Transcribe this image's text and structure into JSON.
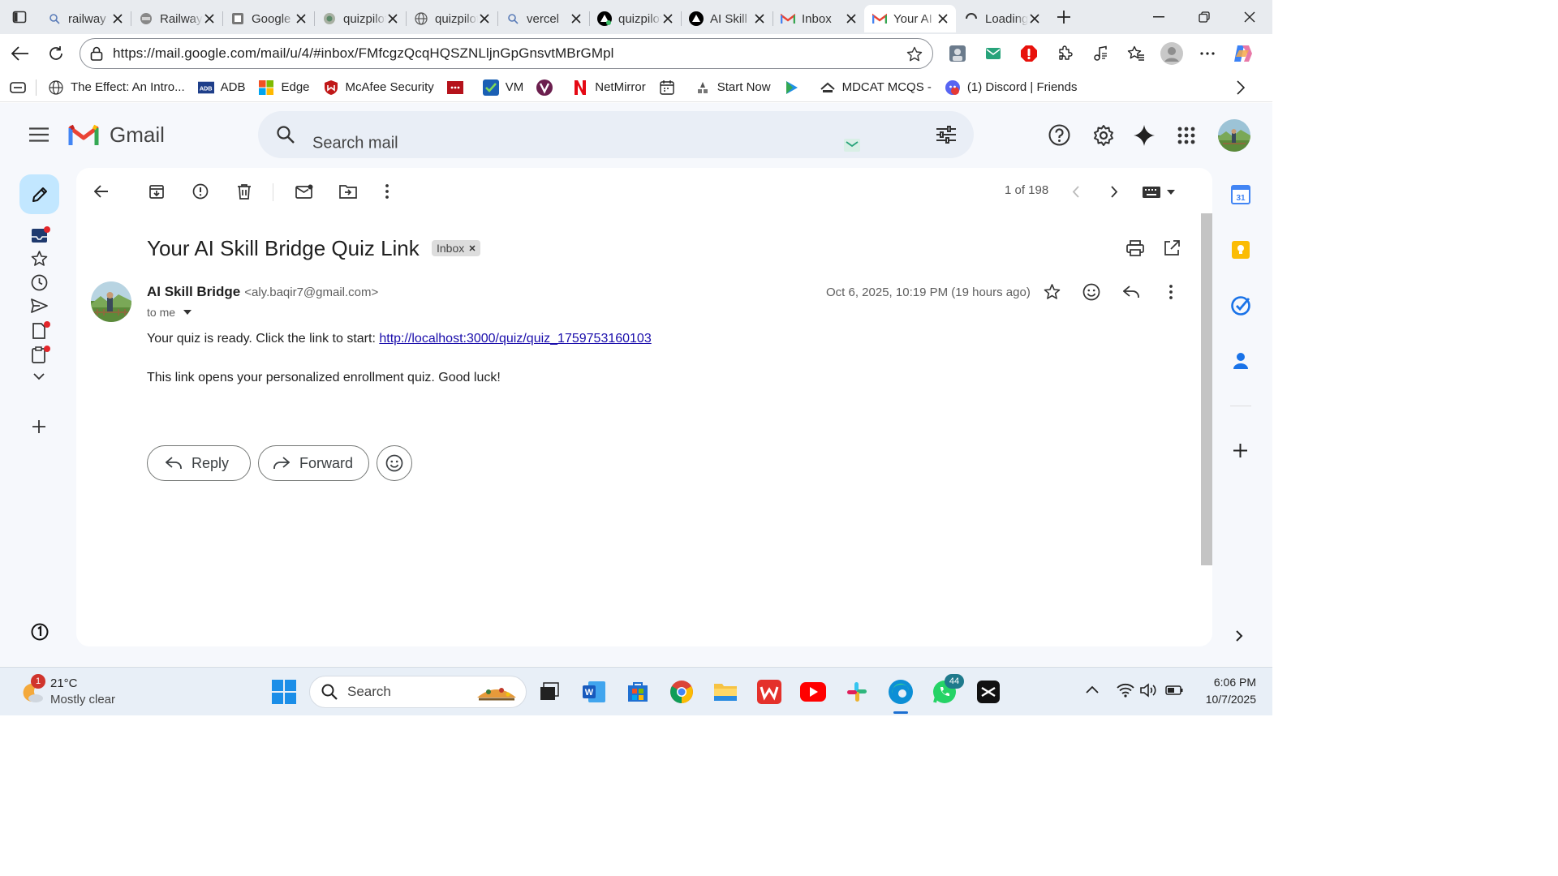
{
  "tabs": [
    {
      "title": "railway",
      "icon": "search-icon"
    },
    {
      "title": "Railway",
      "icon": "railway-icon"
    },
    {
      "title": "Google",
      "icon": "google-icon"
    },
    {
      "title": "quizpilot",
      "icon": "quizpilot-icon"
    },
    {
      "title": "quizpilot",
      "icon": "globe-icon"
    },
    {
      "title": "vercel",
      "icon": "search-icon"
    },
    {
      "title": "quizpilot",
      "icon": "vercel-icon"
    },
    {
      "title": "AI Skill",
      "icon": "vercel-icon"
    },
    {
      "title": "Inbox",
      "icon": "gmail-icon"
    },
    {
      "title": "Your AI",
      "icon": "gmail-icon",
      "active": true
    },
    {
      "title": "Loading",
      "icon": "loading-icon"
    }
  ],
  "address": {
    "url": "https://mail.google.com/mail/u/4/#inbox/FMfcgzQcqHQSZNLljnGpGnsvtMBrGMpl"
  },
  "bookmarks": [
    {
      "label": "The Effect: An Intro...",
      "icon": "globe-icon"
    },
    {
      "label": "ADB",
      "icon": "adb-icon"
    },
    {
      "label": "Edge",
      "icon": "microsoft-icon"
    },
    {
      "label": "McAfee Security",
      "icon": "mcafee-icon"
    },
    {
      "label": "",
      "icon": "red-app-icon"
    },
    {
      "label": "VM",
      "icon": "check-icon"
    },
    {
      "label": "",
      "icon": "v-icon"
    },
    {
      "label": "NetMirror",
      "icon": "netmirror-icon"
    },
    {
      "label": "",
      "icon": "calendar-icon"
    },
    {
      "label": "Start Now",
      "icon": "start-icon"
    },
    {
      "label": "",
      "icon": "play-icon"
    },
    {
      "label": "MDCAT MCQS -",
      "icon": "mdcat-icon"
    },
    {
      "label": "(1) Discord | Friends",
      "icon": "discord-icon"
    }
  ],
  "gmail": {
    "brand": "Gmail",
    "search_placeholder": "Search mail",
    "pagination": "1 of 198",
    "subject": "Your AI Skill Bridge Quiz Link",
    "label_chip": "Inbox",
    "sender_name": "AI Skill Bridge",
    "sender_email": "<aly.baqir7@gmail.com>",
    "recipient": "to me",
    "date": "Oct 6, 2025, 10:19 PM (19 hours ago)",
    "body_prefix": "Your quiz is ready. Click the link to start: ",
    "body_link": "http://localhost:3000/quiz/quiz_1759753160103",
    "body_line2": "This link opens your personalized enrollment quiz. Good luck!",
    "reply_label": "Reply",
    "forward_label": "Forward",
    "calendar_day": "31"
  },
  "taskbar": {
    "weather_temp": "21°C",
    "weather_desc": "Mostly clear",
    "weather_badge": "1",
    "search_label": "Search",
    "whatsapp_badge": "44",
    "time": "6:06 PM",
    "date": "10/7/2025"
  },
  "colors": {
    "gmail_red": "#ea4335",
    "link_blue": "#1a0dab",
    "search_bg": "#e9eef6",
    "compose_bg": "#c2e7ff"
  }
}
